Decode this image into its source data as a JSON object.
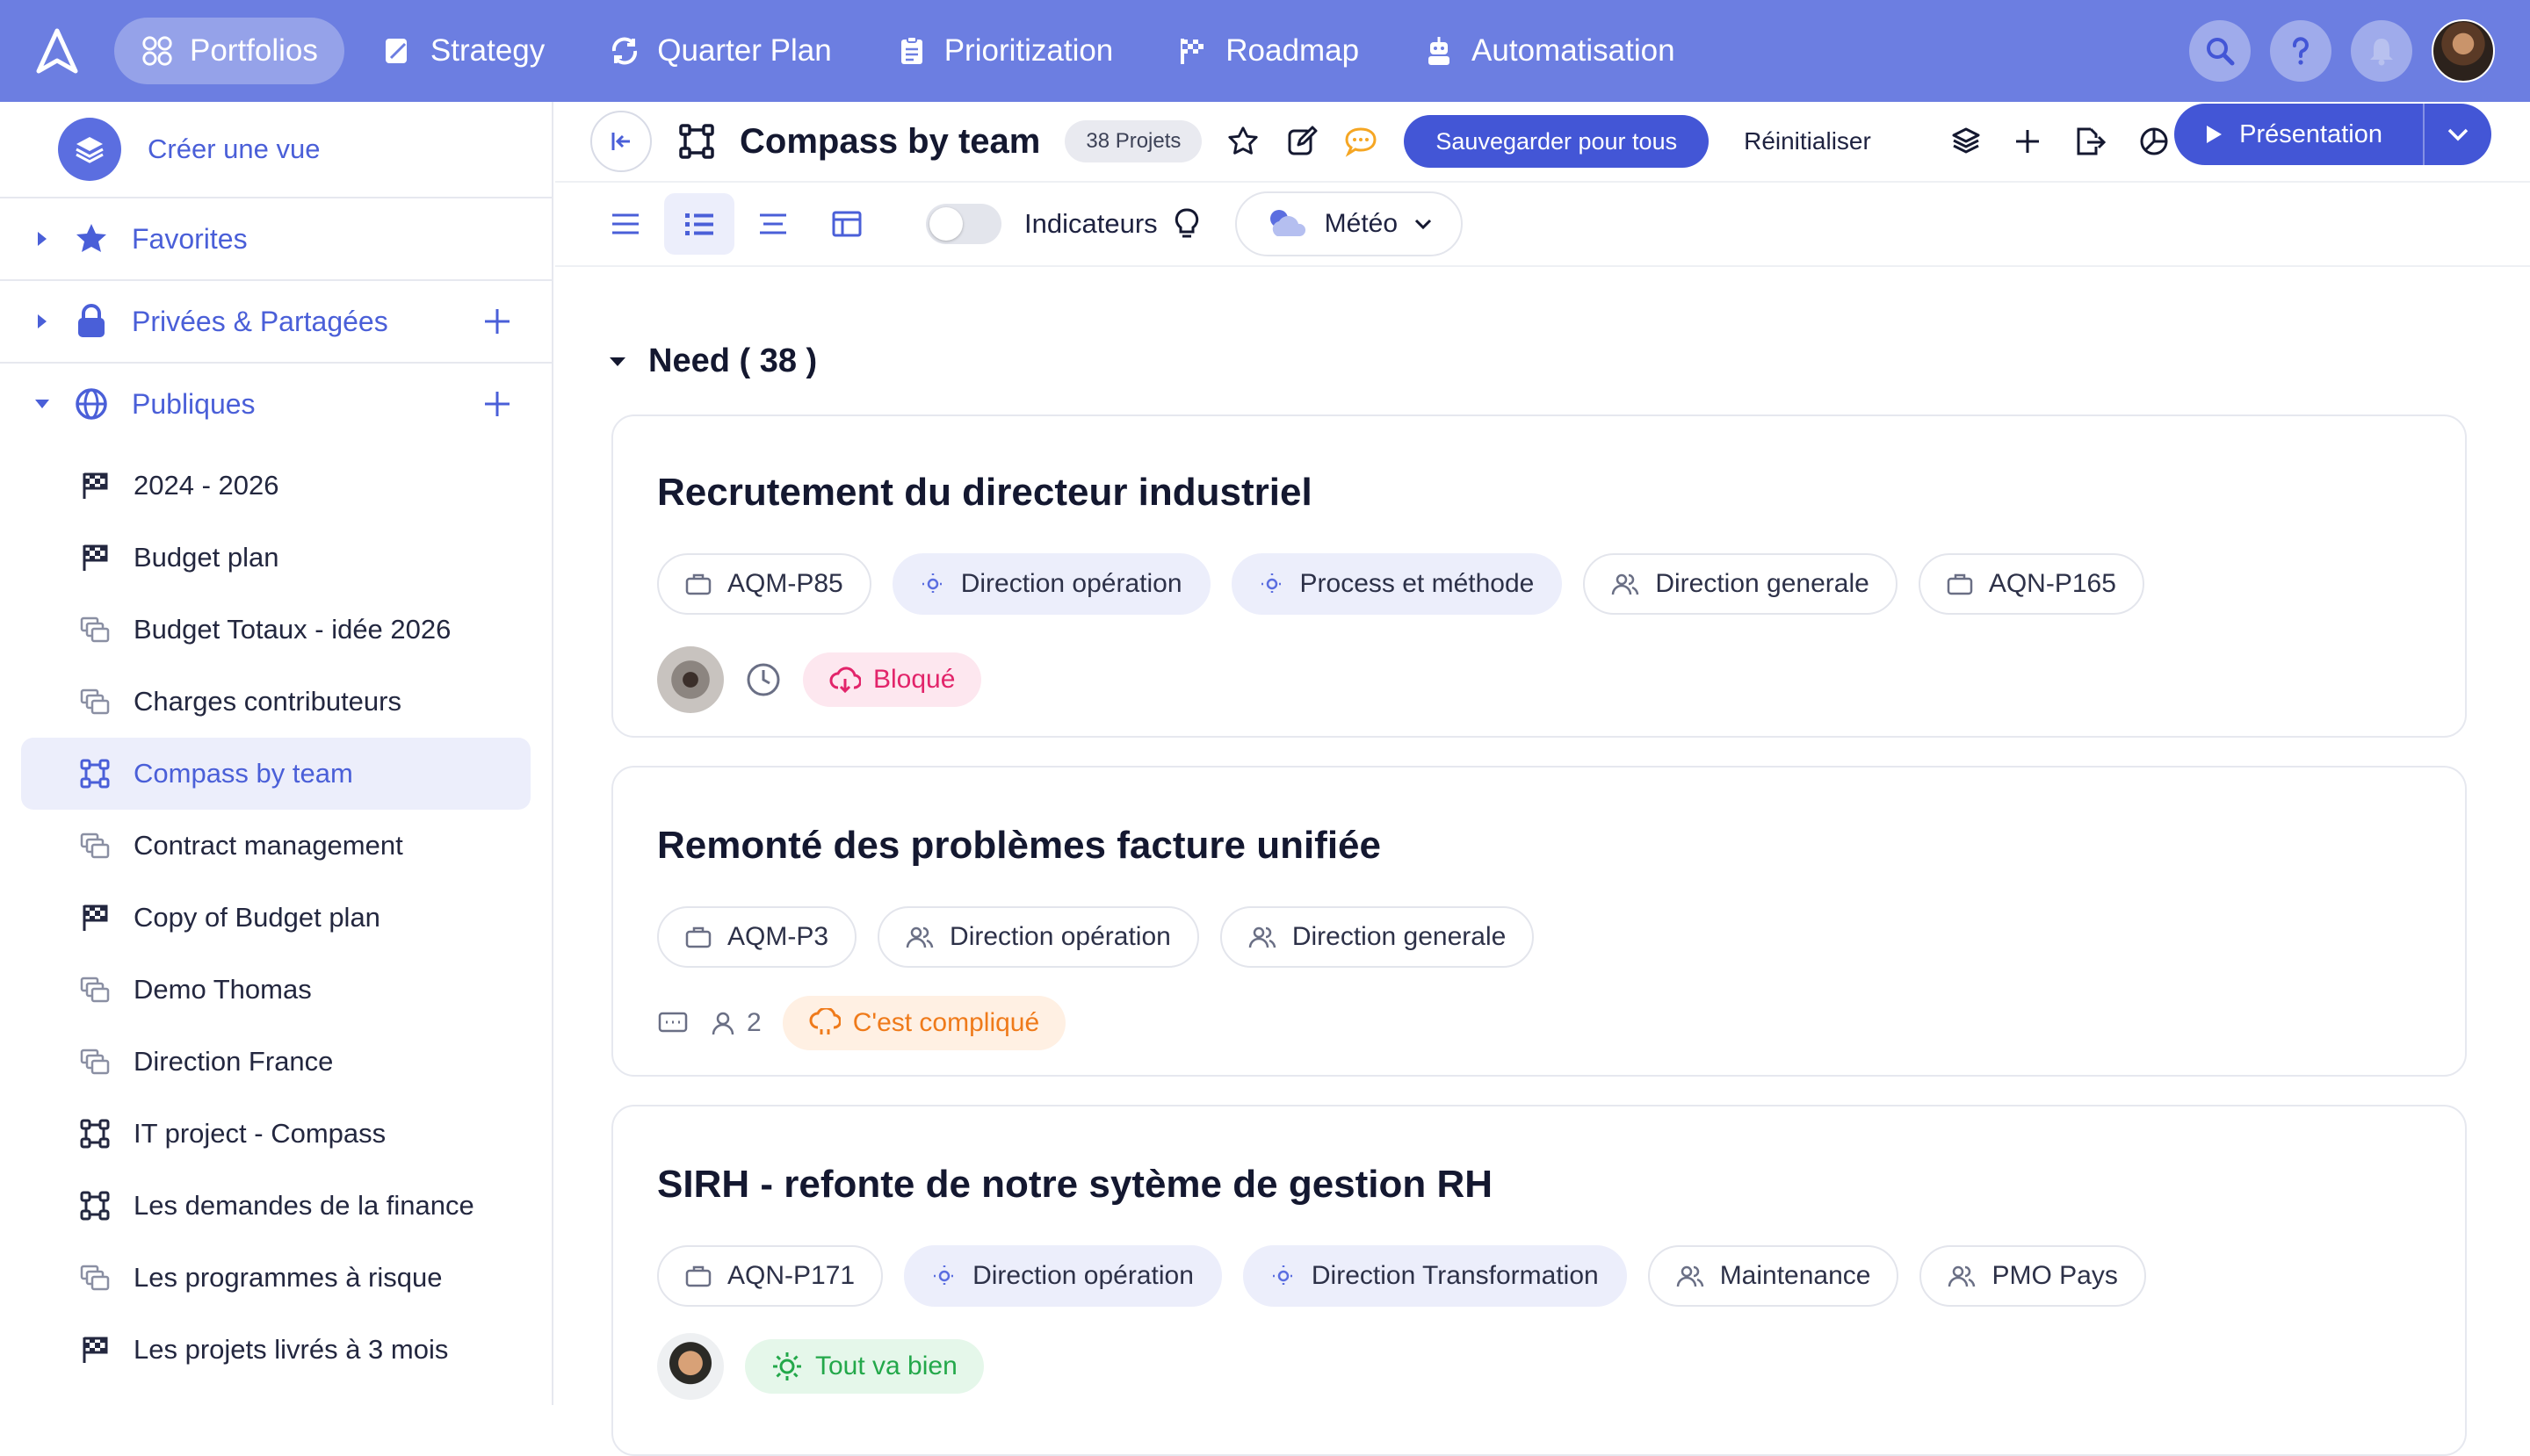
{
  "nav": {
    "items": [
      {
        "label": "Portfolios",
        "icon": "portfolio-icon",
        "active": true
      },
      {
        "label": "Strategy",
        "icon": "strategy-icon"
      },
      {
        "label": "Quarter Plan",
        "icon": "quarter-plan-icon"
      },
      {
        "label": "Prioritization",
        "icon": "prioritization-icon"
      },
      {
        "label": "Roadmap",
        "icon": "roadmap-flag-icon"
      },
      {
        "label": "Automatisation",
        "icon": "robot-icon"
      }
    ]
  },
  "sidebar": {
    "create_view": "Créer une vue",
    "sections": [
      {
        "label": "Favorites",
        "icon": "star-icon"
      },
      {
        "label": "Privées & Partagées",
        "icon": "lock-icon"
      },
      {
        "label": "Publiques",
        "icon": "globe-icon"
      }
    ],
    "items": [
      {
        "label": "2024 - 2026",
        "icon": "flag-icon"
      },
      {
        "label": "Budget plan",
        "icon": "flag-icon"
      },
      {
        "label": "Budget Totaux - idée 2026",
        "icon": "portfolio-view-icon"
      },
      {
        "label": "Charges contributeurs",
        "icon": "portfolio-view-icon"
      },
      {
        "label": "Compass by team",
        "icon": "compass-view-icon",
        "active": true
      },
      {
        "label": "Contract management",
        "icon": "portfolio-view-icon"
      },
      {
        "label": "Copy of Budget plan",
        "icon": "flag-icon"
      },
      {
        "label": "Demo Thomas",
        "icon": "portfolio-view-icon"
      },
      {
        "label": "Direction France",
        "icon": "portfolio-view-icon"
      },
      {
        "label": "IT project - Compass",
        "icon": "compass-view-icon"
      },
      {
        "label": "Les demandes de la finance",
        "icon": "compass-view-icon"
      },
      {
        "label": "Les programmes à risque",
        "icon": "portfolio-view-icon"
      },
      {
        "label": "Les projets livrés à 3 mois",
        "icon": "flag-icon"
      }
    ]
  },
  "header": {
    "title": "Compass by team",
    "count": "38 Projets",
    "save_label": "Sauvegarder pour tous",
    "reset_label": "Réinitialiser",
    "present_label": "Présentation"
  },
  "toolbar": {
    "indicators_label": "Indicateurs",
    "weather_label": "Météo"
  },
  "group": {
    "label": "Need ( 38 )"
  },
  "cards": [
    {
      "title": "Recrutement du directeur industriel",
      "tags": [
        {
          "label": "AQM-P85",
          "icon": "briefcase-icon"
        },
        {
          "label": "Direction opération",
          "icon": "target-icon"
        },
        {
          "label": "Process et méthode",
          "icon": "target-icon"
        },
        {
          "label": "Direction generale",
          "icon": "users-icon"
        },
        {
          "label": "AQN-P165",
          "icon": "briefcase-icon"
        }
      ],
      "status": "Bloqué"
    },
    {
      "title": "Remonté des problèmes facture unifiée",
      "tags": [
        {
          "label": "AQM-P3",
          "icon": "briefcase-icon"
        },
        {
          "label": "Direction opération",
          "icon": "users-icon"
        },
        {
          "label": "Direction generale",
          "icon": "users-icon"
        }
      ],
      "people_count": "2",
      "status": "C'est compliqué"
    },
    {
      "title": "SIRH - refonte de notre sytème de gestion RH",
      "tags": [
        {
          "label": "AQN-P171",
          "icon": "briefcase-icon"
        },
        {
          "label": "Direction opération",
          "icon": "target-icon"
        },
        {
          "label": "Direction Transformation",
          "icon": "target-icon"
        },
        {
          "label": "Maintenance",
          "icon": "users-icon"
        },
        {
          "label": "PMO Pays",
          "icon": "users-icon"
        }
      ],
      "status": "Tout va bien"
    }
  ],
  "colors": {
    "nav_bg": "#6c7ee1",
    "primary": "#4356d6",
    "status_blocked": "#e2246a",
    "status_complicated": "#ef7a1a",
    "status_ok": "#23a84a"
  }
}
